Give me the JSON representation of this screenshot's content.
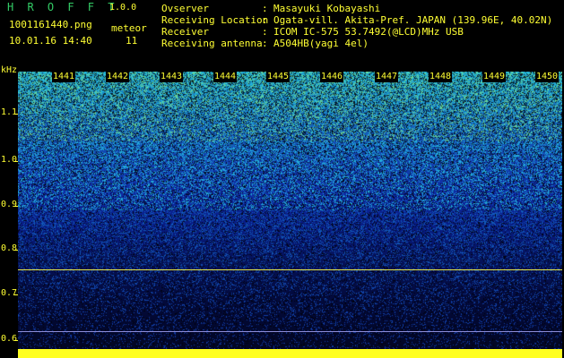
{
  "header": {
    "app_title": "H R O F F T",
    "app_version": "1.0.0",
    "file_name": "1001161440.png",
    "meteor_label": "meteor",
    "date_time": "10.01.16 14:40",
    "meteor_count": "11"
  },
  "info": {
    "observer_key": "Ovserver",
    "observer_val": "Masayuki Kobayashi",
    "location_key": "Receiving Location",
    "location_val": "Ogata-vill. Akita-Pref. JAPAN (139.96E, 40.02N)",
    "receiver_key": "Receiver",
    "receiver_val": "ICOM IC-575 53.7492(@LCD)MHz USB",
    "antenna_key": "Receiving antenna",
    "antenna_val": "A504HB(yagi 4el)",
    "colon": ":"
  },
  "axis": {
    "y_unit": "kHz",
    "y_ticks": [
      "1.1",
      "1.0",
      "0.9",
      "0.8",
      "0.7",
      "0.6"
    ],
    "x_ticks": [
      "1441",
      "1442",
      "1443",
      "1444",
      "1445",
      "1446",
      "1447",
      "1448",
      "1449",
      "1450"
    ]
  },
  "colors": {
    "label": "#ffff33",
    "title": "#33cc66",
    "info": "#33ffff",
    "baseline": "#ffff22"
  }
}
